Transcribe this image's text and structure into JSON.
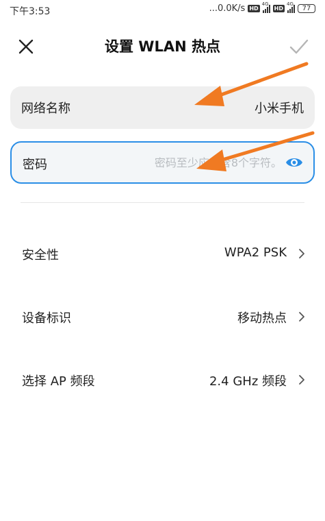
{
  "status_bar": {
    "time": "下午3:53",
    "speed": "...0.0K/s",
    "hd": "HD",
    "network": "4G",
    "battery": "77"
  },
  "header": {
    "title": "设置 WLAN 热点"
  },
  "form": {
    "network_name": {
      "label": "网络名称",
      "value": "小米手机"
    },
    "password": {
      "label": "密码",
      "placeholder": "密码至少应包含8个字符。"
    }
  },
  "settings": [
    {
      "label": "安全性",
      "value": "WPA2 PSK"
    },
    {
      "label": "设备标识",
      "value": "移动热点"
    },
    {
      "label": "选择 AP 频段",
      "value": "2.4 GHz 频段"
    }
  ],
  "icons": {
    "close": "close-icon",
    "confirm": "check-icon",
    "show_password": "eye-icon",
    "row_arrow": "chevron-right-icon"
  },
  "colors": {
    "accent": "#2a8ee6",
    "annotation_arrow": "#f07a22"
  }
}
